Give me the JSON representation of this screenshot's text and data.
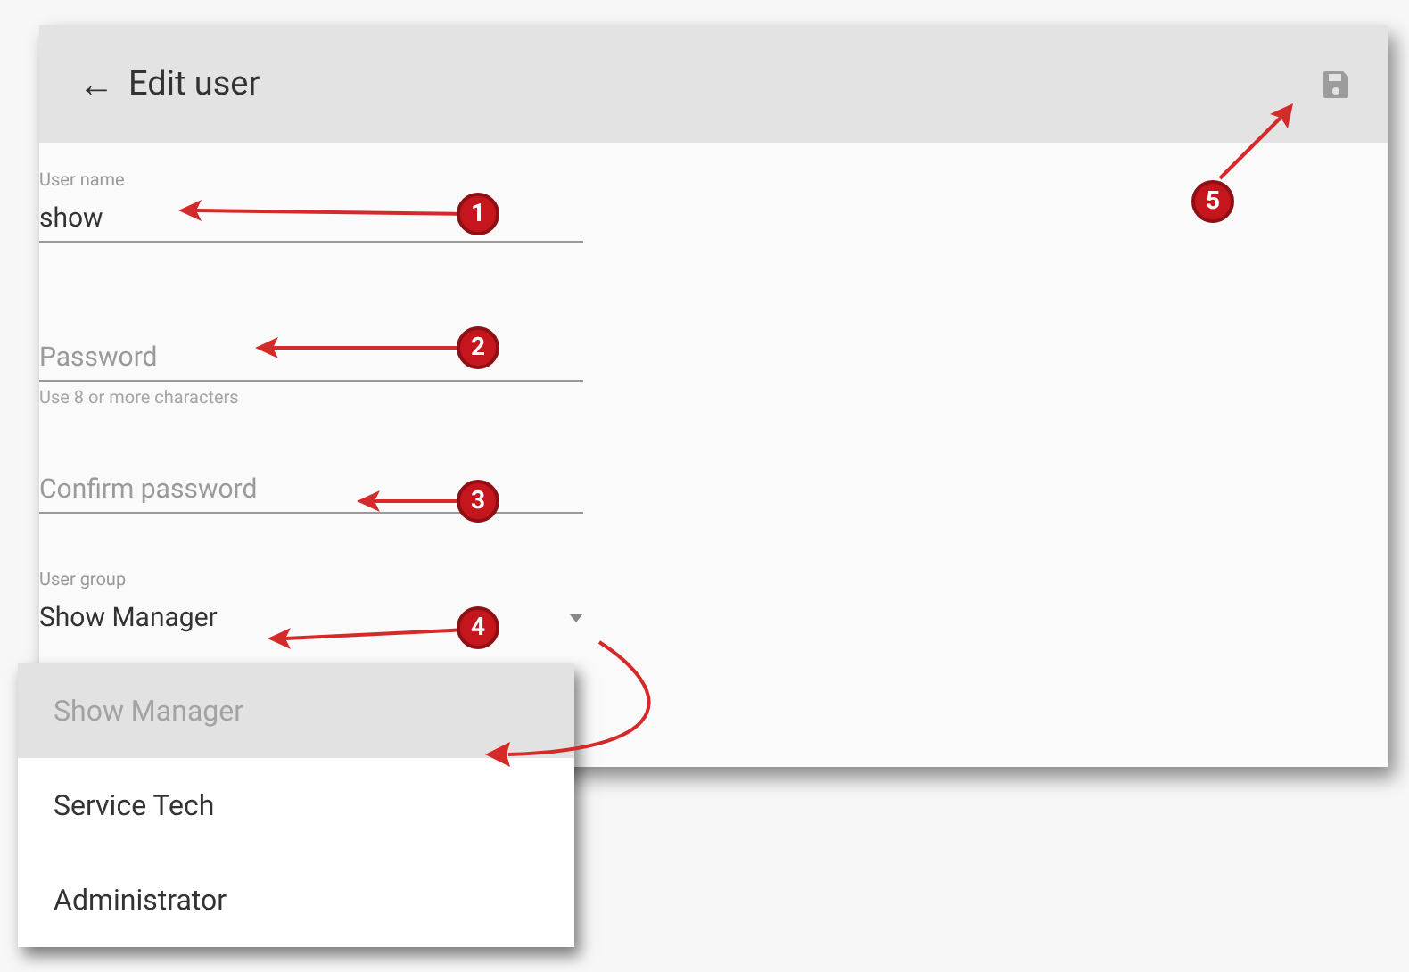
{
  "header": {
    "back_glyph": "←",
    "title": "Edit user"
  },
  "fields": [
    {
      "kind": "text",
      "label": "User name",
      "value": "show"
    },
    {
      "kind": "text",
      "placeholder": "Password",
      "helper": "Use 8 or more characters"
    },
    {
      "kind": "text",
      "placeholder": "Confirm password"
    },
    {
      "kind": "select",
      "label": "User group",
      "value": "Show Manager"
    }
  ],
  "menu": [
    {
      "label": "Show Manager",
      "selected": true
    },
    {
      "label": "Service Tech",
      "selected": false
    },
    {
      "label": "Administrator",
      "selected": false
    }
  ],
  "callouts": [
    "1",
    "2",
    "3",
    "4",
    "5"
  ]
}
